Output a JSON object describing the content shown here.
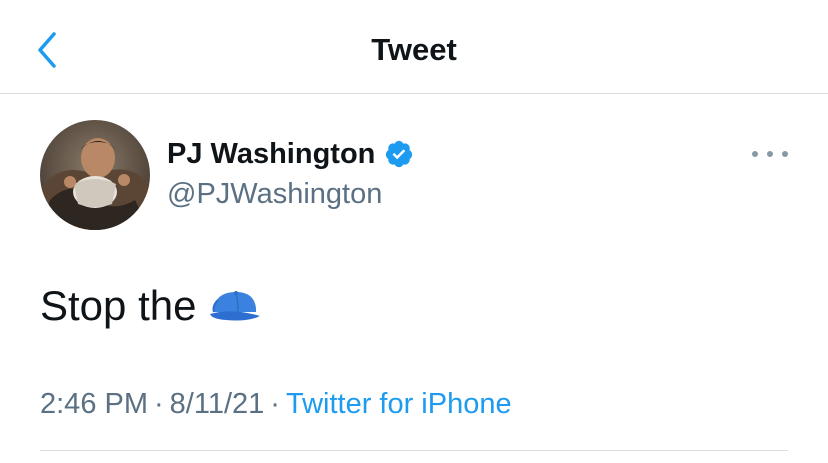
{
  "header": {
    "title": "Tweet",
    "back_icon": "chevron-left-icon"
  },
  "author": {
    "display_name": "PJ Washington",
    "handle": "@PJWashington",
    "verified": true,
    "avatar_icon": "profile-photo"
  },
  "tweet": {
    "text": "Stop the",
    "emoji_icon": "blue-cap-icon"
  },
  "meta": {
    "time": "2:46 PM",
    "separator": "·",
    "date": "8/11/21",
    "source": "Twitter for iPhone"
  },
  "more_icon": "more-horizontal-icon",
  "colors": {
    "accent": "#1d9bf0",
    "secondary_text": "#5b7083",
    "primary_text": "#0f1419",
    "divider": "#d9dde0"
  }
}
